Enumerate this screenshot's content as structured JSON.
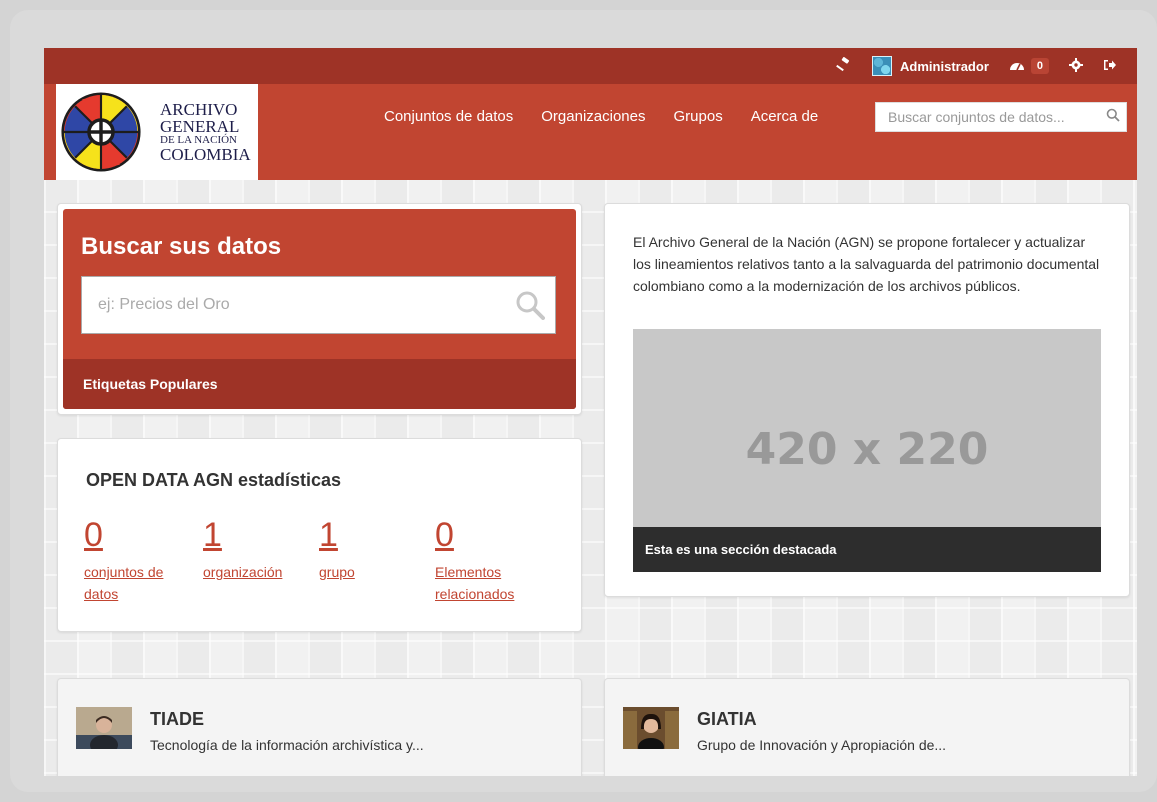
{
  "account": {
    "user_name": "Administrador",
    "dashboard_count": "0",
    "icons": [
      "sysadmin-gavel-icon",
      "user-avatar",
      "dashboard-icon",
      "gear-icon",
      "logout-icon"
    ]
  },
  "brand": {
    "line1": "ARCHIVO",
    "line2": "GENERAL",
    "line3": "DE LA NACIÓN",
    "line4": "COLOMBIA",
    "colors": [
      "#e53a2e",
      "#f6e21b",
      "#2f47a6",
      "#1d1d1d"
    ]
  },
  "nav": {
    "items": [
      "Conjuntos de datos",
      "Organizaciones",
      "Grupos",
      "Acerca de"
    ],
    "search_placeholder": "Buscar conjuntos de datos..."
  },
  "hero": {
    "title": "Buscar sus datos",
    "search_placeholder": "ej: Precios del Oro",
    "tags_label": "Etiquetas Populares"
  },
  "stats": {
    "title": "OPEN DATA AGN estadísticas",
    "items": [
      {
        "value": "0",
        "label": "conjuntos de datos"
      },
      {
        "value": "1",
        "label": "organización"
      },
      {
        "value": "1",
        "label": "grupo"
      },
      {
        "value": "0",
        "label": "Elementos relacionados"
      }
    ]
  },
  "featured": {
    "description": "El Archivo General de la Nación (AGN) se propone fortalecer y actualizar los lineamientos relativos tanto a la salvaguarda del patrimonio documental colombiano como a la modernización de los archivos públicos.",
    "image_text": "420 x 220",
    "caption": "Esta es una sección destacada"
  },
  "groups": [
    {
      "title": "TIADE",
      "description": "Tecnología de la información archivística y..."
    },
    {
      "title": "GIATIA",
      "description": "Grupo de Innovación y Apropiación de..."
    }
  ],
  "colors": {
    "primary": "#c14531",
    "primary_dark": "#9e3326",
    "caption_bg": "#2d2d2d"
  }
}
